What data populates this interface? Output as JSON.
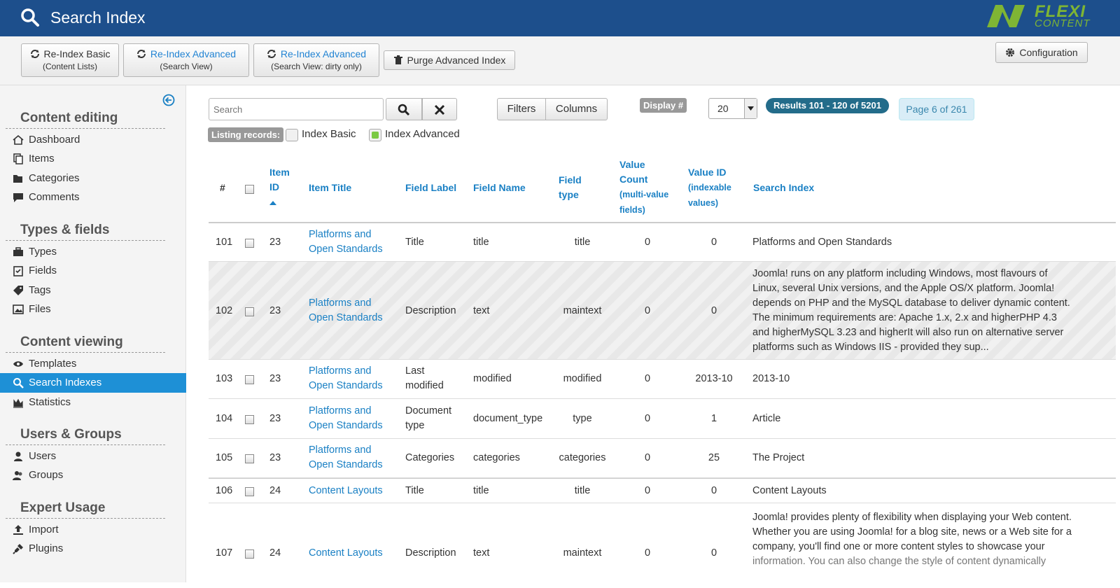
{
  "header": {
    "title": "Search Index",
    "logo_top": "FLEXI",
    "logo_bottom": "CONTENT"
  },
  "toolbar": {
    "reindex_basic": {
      "label": "Re-Index Basic",
      "sub": "(Content Lists)"
    },
    "reindex_advanced": {
      "label": "Re-Index Advanced",
      "sub": "(Search View)"
    },
    "reindex_dirty": {
      "label": "Re-Index Advanced",
      "sub": "(Search View: dirty only)"
    },
    "purge_label": "Purge Advanced Index",
    "configuration_label": "Configuration"
  },
  "sidebar": {
    "groups": [
      {
        "title": "Content editing",
        "items": [
          "Dashboard",
          "Items",
          "Categories",
          "Comments"
        ]
      },
      {
        "title": "Types & fields",
        "items": [
          "Types",
          "Fields",
          "Tags",
          "Files"
        ]
      },
      {
        "title": "Content viewing",
        "items": [
          "Templates",
          "Search Indexes",
          "Statistics"
        ]
      },
      {
        "title": "Users & Groups",
        "items": [
          "Users",
          "Groups"
        ]
      },
      {
        "title": "Expert Usage",
        "items": [
          "Import",
          "Plugins"
        ]
      }
    ],
    "active_item": "Search Indexes"
  },
  "filters": {
    "search_placeholder": "Search",
    "filters_label": "Filters",
    "columns_label": "Columns",
    "display_label": "Display #",
    "display_value": "20",
    "results_label": "Results 101 - 120 of 5201",
    "page_label": "Page 6 of 261",
    "listing_label": "Listing records:",
    "index_basic_label": "Index Basic",
    "index_advanced_label": "Index Advanced"
  },
  "table": {
    "headers": {
      "num": "#",
      "item_id_1": "Item",
      "item_id_2": "ID",
      "item_title": "Item Title",
      "field_label": "Field Label",
      "field_name": "Field Name",
      "field_type_1": "Field",
      "field_type_2": "type",
      "value_count_1": "Value",
      "value_count_2": "Count",
      "value_count_3": "(multi-value",
      "value_count_4": "fields)",
      "value_id_1": "Value ID",
      "value_id_2": "(indexable",
      "value_id_3": "values)",
      "search_index": "Search Index"
    },
    "rows": [
      {
        "num": "101",
        "item_id": "23",
        "title1": "Platforms and",
        "title2": "Open Standards",
        "label1": "Title",
        "label2": "",
        "name": "title",
        "type": "title",
        "count": "0",
        "value_id": "0",
        "index": [
          "Platforms and Open Standards"
        ]
      },
      {
        "num": "102",
        "item_id": "23",
        "title1": "Platforms and",
        "title2": "Open Standards",
        "label1": "Description",
        "label2": "",
        "name": "text",
        "type": "maintext",
        "count": "0",
        "value_id": "0",
        "index": [
          "Joomla! runs on any platform including Windows, most flavours of",
          "Linux, several Unix versions, and the Apple OS/X platform. Joomla!",
          "depends on PHP and the MySQL database to deliver dynamic content.",
          "The minimum requirements are: Apache 1.x, 2.x and higherPHP 4.3",
          "and higherMySQL 3.23 and higherIt will also run on alternative server",
          "platforms such as Windows IIS - provided they sup..."
        ]
      },
      {
        "num": "103",
        "item_id": "23",
        "title1": "Platforms and",
        "title2": "Open Standards",
        "label1": "Last",
        "label2": "modified",
        "name": "modified",
        "type": "modified",
        "count": "0",
        "value_id": "2013-10",
        "index": [
          "2013-10"
        ]
      },
      {
        "num": "104",
        "item_id": "23",
        "title1": "Platforms and",
        "title2": "Open Standards",
        "label1": "Document",
        "label2": "type",
        "name": "document_type",
        "type": "type",
        "count": "0",
        "value_id": "1",
        "index": [
          "Article"
        ]
      },
      {
        "num": "105",
        "item_id": "23",
        "title1": "Platforms and",
        "title2": "Open Standards",
        "label1": "Categories",
        "label2": "",
        "name": "categories",
        "type": "categories",
        "count": "0",
        "value_id": "25",
        "index": [
          "The Project"
        ]
      },
      {
        "num": "106",
        "item_id": "24",
        "title1": "Content Layouts",
        "title2": "",
        "label1": "Title",
        "label2": "",
        "name": "title",
        "type": "title",
        "count": "0",
        "value_id": "0",
        "index": [
          "Content Layouts"
        ]
      },
      {
        "num": "107",
        "item_id": "24",
        "title1": "Content Layouts",
        "title2": "",
        "label1": "Description",
        "label2": "",
        "name": "text",
        "type": "maintext",
        "count": "0",
        "value_id": "0",
        "index": [
          "Joomla! provides plenty of flexibility when displaying your Web content.",
          "Whether you are using Joomla! for a blog site, news or a Web site for a",
          "company, you'll find one or more content styles to showcase your",
          "information. You can also change the style of content dynamically"
        ]
      }
    ]
  },
  "colors": {
    "header_bg": "#1d4f8c",
    "accent": "#1a80c4",
    "active_bg": "#1e90d6",
    "results_badge": "#236c8a",
    "logo_green": "#7fb534"
  }
}
